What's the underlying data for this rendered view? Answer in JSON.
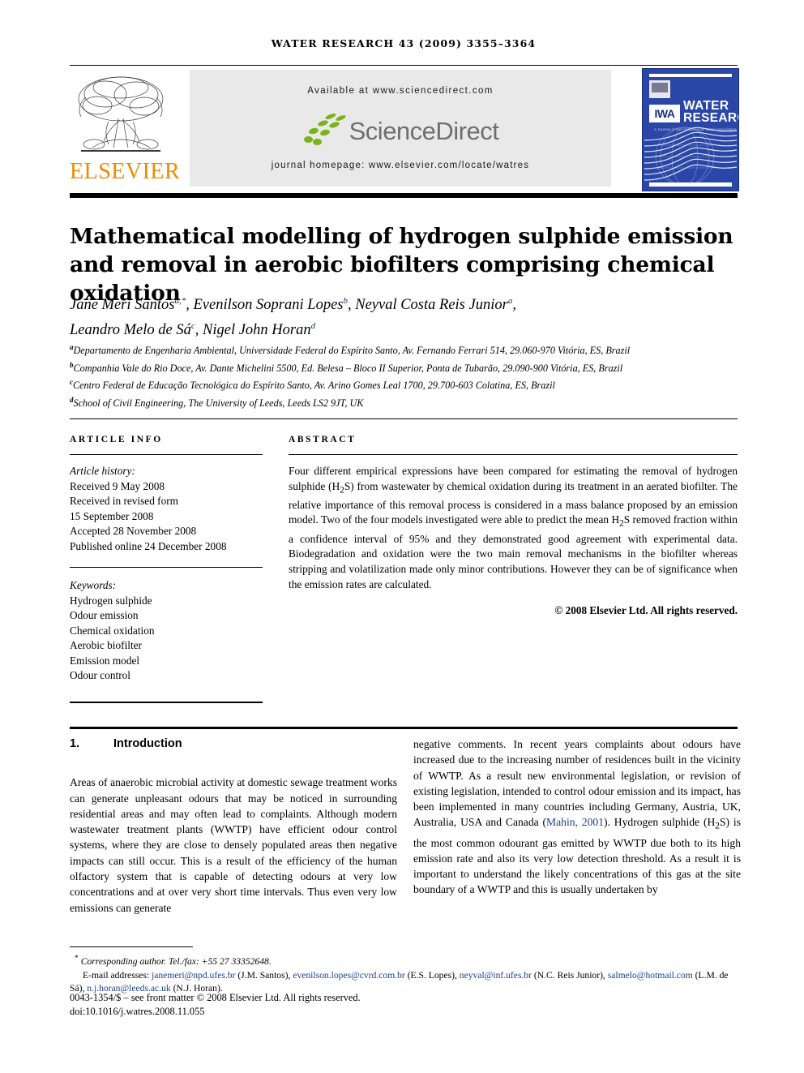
{
  "running_head": "WATER RESEARCH 43 (2009) 3355–3364",
  "masthead": {
    "publisher_name": "ELSEVIER",
    "available_at": "Available at www.sciencedirect.com",
    "sciencedirect_wordmark": "ScienceDirect",
    "journal_homepage": "journal homepage: www.elsevier.com/locate/watres",
    "cover": {
      "iwa_label": "IWA",
      "title_line1": "WATER",
      "title_line2": "RESEARCH",
      "subtitle": "A Journal of the International Water Association"
    }
  },
  "article": {
    "title": "Mathematical modelling of hydrogen sulphide emission and removal in aerobic biofilters comprising chemical oxidation",
    "authors_line1_parts": [
      {
        "name": "Jane Meri Santos",
        "sup": "a,*"
      },
      {
        "name": "Evenilson Soprani Lopes",
        "sup": "b"
      },
      {
        "name": "Neyval Costa Reis Junior",
        "sup": "a"
      }
    ],
    "authors_line2_parts": [
      {
        "name": "Leandro Melo de Sá",
        "sup": "c"
      },
      {
        "name": "Nigel John Horan",
        "sup": "d"
      }
    ],
    "affiliations": [
      {
        "mark": "a",
        "text": "Departamento de Engenharia Ambiental, Universidade Federal do Espírito Santo, Av. Fernando Ferrari 514, 29.060-970 Vitória, ES, Brazil"
      },
      {
        "mark": "b",
        "text": "Companhia Vale do Rio Doce, Av. Dante Michelini 5500, Ed. Belesa – Bloco II Superior, Ponta de Tubarão, 29.090-900 Vitória, ES, Brazil"
      },
      {
        "mark": "c",
        "text": "Centro Federal de Educação Tecnológica do Espírito Santo, Av. Arino Gomes Leal 1700, 29.700-603 Colatina, ES, Brazil"
      },
      {
        "mark": "d",
        "text": "School of Civil Engineering, The University of Leeds, Leeds LS2 9JT, UK"
      }
    ]
  },
  "article_info": {
    "heading": "ARTICLE INFO",
    "history_label": "Article history:",
    "history": [
      "Received 9 May 2008",
      "Received in revised form",
      "15 September 2008",
      "Accepted 28 November 2008",
      "Published online 24 December 2008"
    ],
    "keywords_label": "Keywords:",
    "keywords": [
      "Hydrogen sulphide",
      "Odour emission",
      "Chemical oxidation",
      "Aerobic biofilter",
      "Emission model",
      "Odour control"
    ]
  },
  "abstract": {
    "heading": "ABSTRACT",
    "text_part1": "Four different empirical expressions have been compared for estimating the removal of hydrogen sulphide (H",
    "sub1": "2",
    "text_part2": "S) from wastewater by chemical oxidation during its treatment in an aerated biofilter. The relative importance of this removal process is considered in a mass balance proposed by an emission model. Two of the four models investigated were able to predict the mean H",
    "sub2": "2",
    "text_part3": "S removed fraction within a confidence interval of 95% and they demonstrated good agreement with experimental data. Biodegradation and oxidation were the two main removal mechanisms in the biofilter whereas stripping and volatilization made only minor contributions. However they can be of significance when the emission rates are calculated.",
    "copyright": "© 2008 Elsevier Ltd. All rights reserved."
  },
  "body": {
    "section_number": "1.",
    "section_title": "Introduction",
    "left_column": "Areas of anaerobic microbial activity at domestic sewage treatment works can generate unpleasant odours that may be noticed in surrounding residential areas and may often lead to complaints. Although modern wastewater treatment plants (WWTP) have efficient odour control systems, where they are close to densely populated areas then negative impacts can still occur. This is a result of the efficiency of the human olfactory system that is capable of detecting odours at very low concentrations and at over very short time intervals. Thus even very low emissions can generate",
    "right_column_part1": "negative comments. In recent years complaints about odours have increased due to the increasing number of residences built in the vicinity of WWTP. As a result new environmental legislation, or revision of existing legislation, intended to control odour emission and its impact, has been implemented in many countries including Germany, Austria, UK, Australia, USA and Canada (",
    "right_citation": "Mahin, 2001",
    "right_column_part2": "). Hydrogen sulphide (H",
    "right_sub": "2",
    "right_column_part3": "S) is the most common odourant gas emitted by WWTP due both to its high emission rate and also its very low detection threshold. As a result it is important to understand the likely concentrations of this gas at the site boundary of a WWTP and this is usually undertaken by"
  },
  "footnotes": {
    "corresponding_marker": "*",
    "corresponding": "Corresponding author. Tel./fax: +55 27 33352648.",
    "email_label": "E-mail addresses:",
    "emails": [
      {
        "address": "janemeri@npd.ufes.br",
        "person": "(J.M. Santos),"
      },
      {
        "address": "evenilson.lopes@cvrd.com.br",
        "person": "(E.S. Lopes),"
      },
      {
        "address": "neyval@inf.ufes.br",
        "person": "(N.C. Reis Junior),"
      },
      {
        "address": "salmelo@hotmail.com",
        "person": "(L.M. de Sá),"
      },
      {
        "address": "n.j.horan@leeds.ac.uk",
        "person": "(N.J. Horan)."
      }
    ],
    "issn_line": "0043-1354/$ – see front matter © 2008 Elsevier Ltd. All rights reserved.",
    "doi_line": "doi:10.1016/j.watres.2008.11.055"
  },
  "colors": {
    "elsevier_orange": "#ED8B00",
    "sciencedirect_green": "#7AB317",
    "cover_blue": "#2A46A6",
    "link_blue": "#1D3F8F",
    "banner_gray": "#E9E9E9"
  }
}
